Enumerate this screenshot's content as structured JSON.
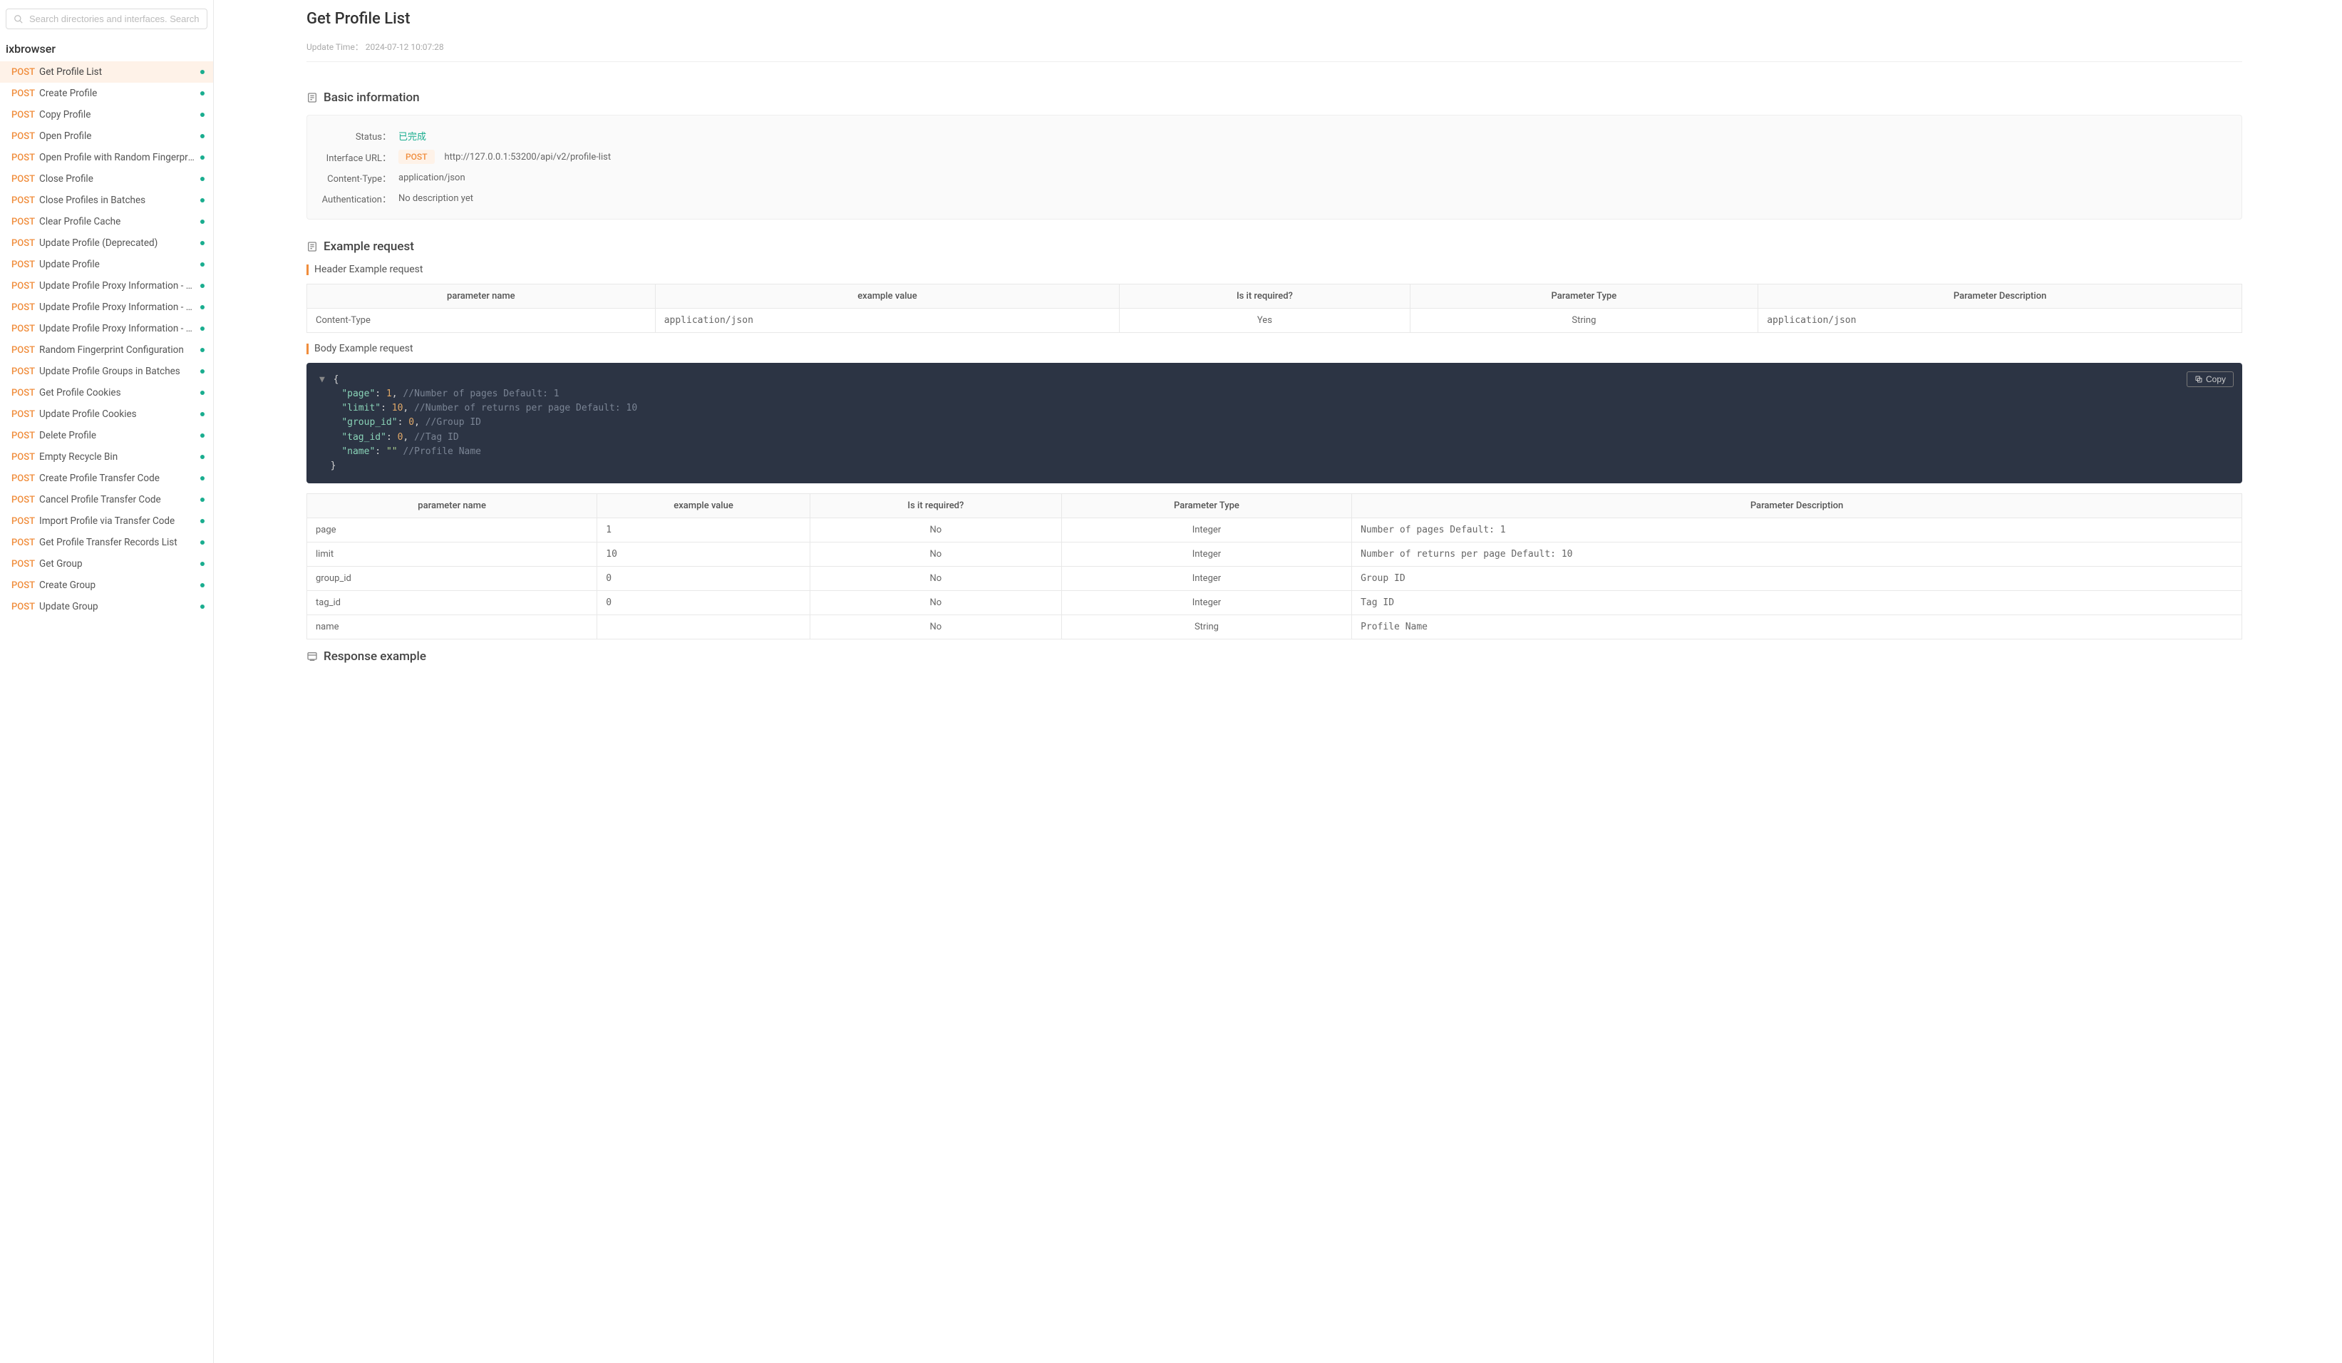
{
  "search": {
    "placeholder": "Search directories and interfaces. Search by name"
  },
  "project": "ixbrowser",
  "sidebar": {
    "items": [
      {
        "method": "POST",
        "label": "Get Profile List",
        "active": true
      },
      {
        "method": "POST",
        "label": "Create Profile"
      },
      {
        "method": "POST",
        "label": "Copy Profile"
      },
      {
        "method": "POST",
        "label": "Open Profile"
      },
      {
        "method": "POST",
        "label": "Open Profile with Random Fingerprint Co…"
      },
      {
        "method": "POST",
        "label": "Close Profile"
      },
      {
        "method": "POST",
        "label": "Close Profiles in Batches"
      },
      {
        "method": "POST",
        "label": "Clear Profile Cache"
      },
      {
        "method": "POST",
        "label": "Update Profile (Deprecated)"
      },
      {
        "method": "POST",
        "label": "Update Profile"
      },
      {
        "method": "POST",
        "label": "Update Profile Proxy Information - Purch…"
      },
      {
        "method": "POST",
        "label": "Update Profile Proxy Information - Purch…"
      },
      {
        "method": "POST",
        "label": "Update Profile Proxy Information - Custo…"
      },
      {
        "method": "POST",
        "label": "Random Fingerprint Configuration"
      },
      {
        "method": "POST",
        "label": "Update Profile Groups in Batches"
      },
      {
        "method": "POST",
        "label": "Get Profile Cookies"
      },
      {
        "method": "POST",
        "label": "Update Profile Cookies"
      },
      {
        "method": "POST",
        "label": "Delete Profile"
      },
      {
        "method": "POST",
        "label": "Empty Recycle Bin"
      },
      {
        "method": "POST",
        "label": "Create Profile Transfer Code"
      },
      {
        "method": "POST",
        "label": "Cancel Profile Transfer Code"
      },
      {
        "method": "POST",
        "label": "Import Profile via Transfer Code"
      },
      {
        "method": "POST",
        "label": "Get Profile Transfer Records List"
      },
      {
        "method": "POST",
        "label": "Get Group"
      },
      {
        "method": "POST",
        "label": "Create Group"
      },
      {
        "method": "POST",
        "label": "Update Group"
      }
    ]
  },
  "page": {
    "title": "Get Profile List",
    "update_time_label": "Update Time：",
    "update_time_value": "2024-07-12 10:07:28"
  },
  "basic": {
    "section_title": "Basic information",
    "status_label": "Status：",
    "status_value": "已完成",
    "url_label": "Interface URL：",
    "method": "POST",
    "url_value": "http://127.0.0.1:53200/api/v2/profile-list",
    "content_type_label": "Content-Type：",
    "content_type_value": "application/json",
    "auth_label": "Authentication：",
    "auth_value": "No description yet"
  },
  "example_request": {
    "section_title": "Example request",
    "header_subtitle": "Header Example request",
    "body_subtitle": "Body Example request"
  },
  "copy_label": "Copy",
  "columns": {
    "param_name": "parameter name",
    "example_value": "example value",
    "required": "Is it required?",
    "type": "Parameter Type",
    "desc": "Parameter Description"
  },
  "header_example": [
    {
      "name": "Content-Type",
      "example": "application/json",
      "required": "Yes",
      "type": "String",
      "desc": "application/json"
    }
  ],
  "body_code": {
    "lines": [
      {
        "key": "\"page\"",
        "value": "1",
        "comma": ",",
        "comment": "//Number of pages Default: 1"
      },
      {
        "key": "\"limit\"",
        "value": "10",
        "comma": ",",
        "comment": "//Number of returns per page Default: 10"
      },
      {
        "key": "\"group_id\"",
        "value": "0",
        "comma": ",",
        "comment": "//Group ID"
      },
      {
        "key": "\"tag_id\"",
        "value": "0",
        "comma": ",",
        "comment": "//Tag ID"
      },
      {
        "key": "\"name\"",
        "value": "\"\"",
        "comma": "",
        "comment": "//Profile Name",
        "is_str": true
      }
    ]
  },
  "body_params": [
    {
      "name": "page",
      "example": "1",
      "required": "No",
      "type": "Integer",
      "desc": "Number of pages Default: 1"
    },
    {
      "name": "limit",
      "example": "10",
      "required": "No",
      "type": "Integer",
      "desc": "Number of returns per page Default: 10"
    },
    {
      "name": "group_id",
      "example": "0",
      "required": "No",
      "type": "Integer",
      "desc": "Group ID"
    },
    {
      "name": "tag_id",
      "example": "0",
      "required": "No",
      "type": "Integer",
      "desc": "Tag ID"
    },
    {
      "name": "name",
      "example": "",
      "required": "No",
      "type": "String",
      "desc": "Profile Name"
    }
  ],
  "response": {
    "section_title": "Response example"
  }
}
